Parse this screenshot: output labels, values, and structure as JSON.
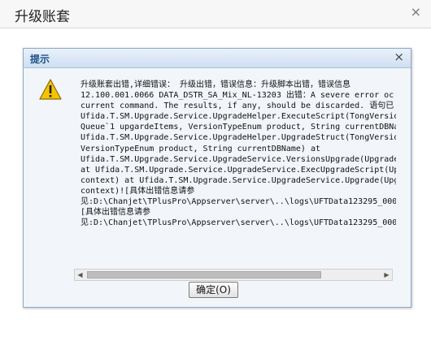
{
  "outer_window": {
    "title": "升级账套",
    "close_glyph": "×"
  },
  "dialog": {
    "title": "提示",
    "close_glyph": "×",
    "icon": "warning-icon",
    "message_lines": [
      "升级账套出错,详细错误： 升级出错，错误信息：升级脚本出错，错误信息",
      "12.100.001.0066 DATA_DSTR_SA_Mix_NL-13203 出错：A severe error oc",
      "current command. The results, if any, should be discarded. 语句已",
      "Ufida.T.SM.Upgrade.Service.UpgradeHelper.ExecuteScript(TongVersio",
      "Queue`1 upgardeItems, VersionTypeEnum product, String currentDBNa",
      "Ufida.T.SM.Upgrade.Service.UpgradeHelper.UpgradeStruct(TongVersio",
      "VersionTypeEnum product, String currentDBName) at",
      "Ufida.T.SM.Upgrade.Service.UpgradeService.VersionsUpgrade(Upgrade",
      "at Ufida.T.SM.Upgrade.Service.UpgradeService.ExecUpgradeScript(Up",
      "context) at Ufida.T.SM.Upgrade.Service.UpgradeService.Upgrade(Upg",
      "context)![具体出错信息请参",
      "见:D:\\Chanjet\\TPlusPro\\Appserver\\server\\..\\logs\\UFTData123295_000",
      "[具体出错信息请参",
      "见:D:\\Chanjet\\TPlusPro\\Appserver\\server\\..\\logs\\UFTData123295_000"
    ],
    "scroll_left_glyph": "◀",
    "scroll_right_glyph": "▶",
    "ok_label": "确定(O)"
  },
  "colors": {
    "accent": "#1d4f87",
    "warning_yellow": "#f5c400"
  }
}
